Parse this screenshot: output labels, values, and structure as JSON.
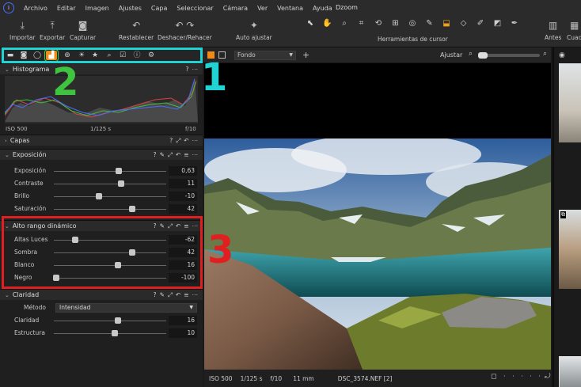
{
  "menubar": {
    "items": [
      "Archivo",
      "Editar",
      "Imagen",
      "Ajustes",
      "Capa",
      "Seleccionar",
      "Cámara",
      "Ver",
      "Ventana",
      "Ayuda"
    ],
    "title": "Dzoom"
  },
  "toolbar": {
    "importar": "Importar",
    "exportar": "Exportar",
    "capturar": "Capturar",
    "restablecer": "Restablecer",
    "deshacer": "Deshacer/Rehacer",
    "auto_ajustar": "Auto ajustar",
    "cursor_tools_label": "Herramientas de cursor",
    "antes": "Antes",
    "cuadricula": "Cuad"
  },
  "annotations": {
    "n1": "1",
    "n2": "2",
    "n3": "3",
    "colors": {
      "cyan": "#22d3d3",
      "green": "#3fc43f",
      "red": "#e02020"
    }
  },
  "histograma": {
    "title": "Histograma",
    "iso": "ISO 500",
    "shutter": "1/125 s",
    "aperture": "f/10"
  },
  "capas": {
    "title": "Capas"
  },
  "exposicion": {
    "title": "Exposición",
    "rows": [
      {
        "label": "Exposición",
        "value": "0,63",
        "pos": 0.58
      },
      {
        "label": "Contraste",
        "value": "11",
        "pos": 0.6
      },
      {
        "label": "Brillo",
        "value": "-10",
        "pos": 0.4
      },
      {
        "label": "Saturación",
        "value": "42",
        "pos": 0.7
      }
    ]
  },
  "hdr": {
    "title": "Alto rango dinámico",
    "rows": [
      {
        "label": "Altas Luces",
        "value": "-62",
        "pos": 0.19
      },
      {
        "label": "Sombra",
        "value": "42",
        "pos": 0.7
      },
      {
        "label": "Blanco",
        "value": "16",
        "pos": 0.57
      },
      {
        "label": "Negro",
        "value": "-100",
        "pos": 0.02
      }
    ]
  },
  "claridad": {
    "title": "Claridad",
    "metodo_label": "Método",
    "metodo_value": "Intensidad",
    "rows": [
      {
        "label": "Claridad",
        "value": "16",
        "pos": 0.57
      },
      {
        "label": "Estructura",
        "value": "10",
        "pos": 0.54
      }
    ]
  },
  "viewer": {
    "background_label": "Fondo",
    "ajustar": "Ajustar",
    "status_iso": "ISO 500",
    "status_shutter": "1/125 s",
    "status_aperture": "f/10",
    "status_focal": "11 mm",
    "status_file": "DSC_3574.NEF [2]"
  }
}
